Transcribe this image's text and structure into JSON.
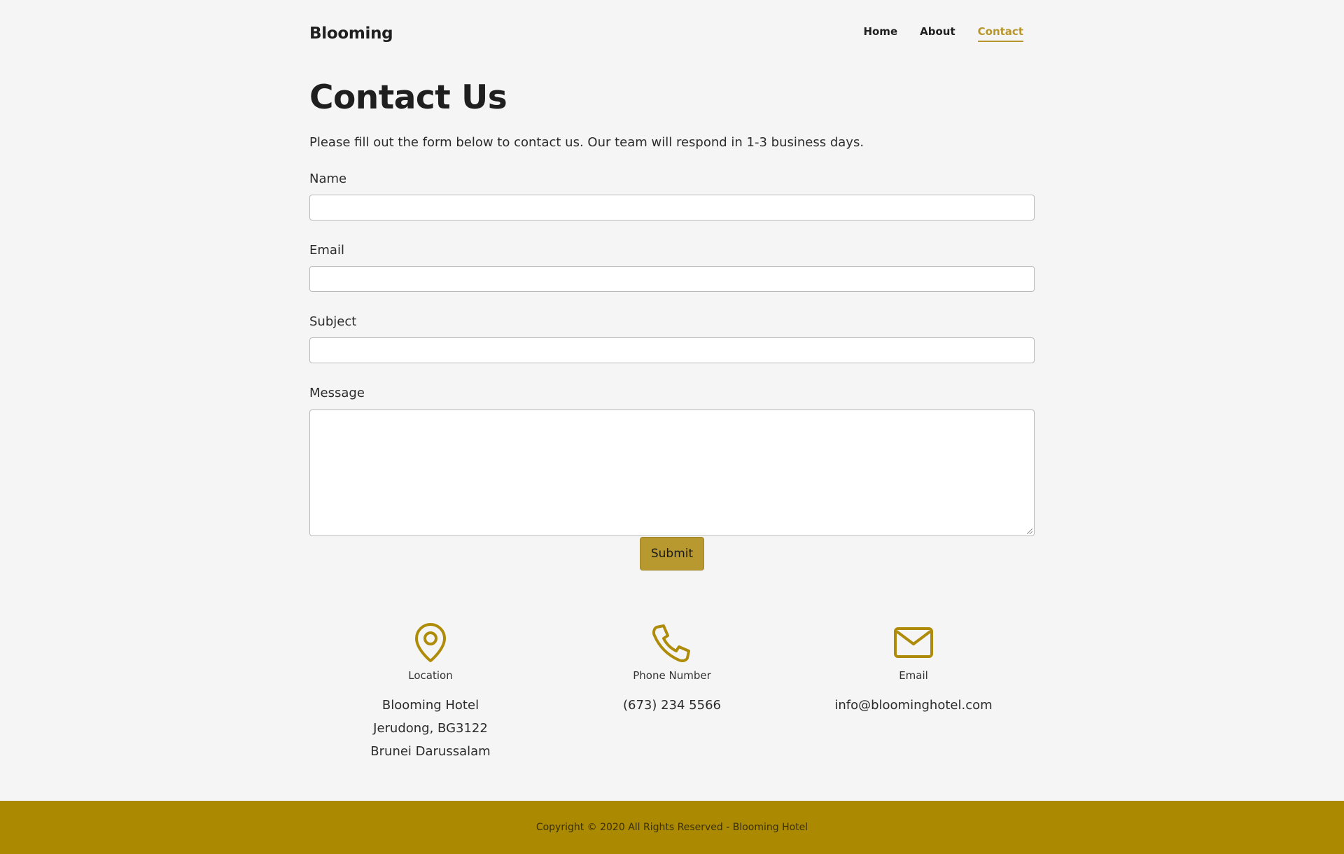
{
  "header": {
    "logo": "Blooming",
    "nav": [
      {
        "label": "Home",
        "active": false
      },
      {
        "label": "About",
        "active": false
      },
      {
        "label": "Contact",
        "active": true
      }
    ]
  },
  "main": {
    "title": "Contact Us",
    "intro": "Please fill out the form below to contact us. Our team will respond in 1-3 business days.",
    "form": {
      "name_label": "Name",
      "name_value": "",
      "email_label": "Email",
      "email_value": "",
      "subject_label": "Subject",
      "subject_value": "",
      "message_label": "Message",
      "message_value": "",
      "submit_label": "Submit"
    }
  },
  "contact_info": {
    "location": {
      "icon": "map-pin-icon",
      "title": "Location",
      "lines": [
        "Blooming Hotel",
        "Jerudong, BG3122",
        "Brunei Darussalam"
      ]
    },
    "phone": {
      "icon": "phone-icon",
      "title": "Phone Number",
      "lines": [
        "(673) 234 5566"
      ]
    },
    "email": {
      "icon": "mail-icon",
      "title": "Email",
      "lines": [
        "info@bloominghotel.com"
      ]
    }
  },
  "footer": {
    "copyright": "Copyright © 2020 All Rights Reserved - Blooming Hotel"
  },
  "colors": {
    "accent": "#b8962a",
    "button": "#b8992f",
    "footer_bg": "#ab8900",
    "page_bg": "#f5f5f5"
  }
}
